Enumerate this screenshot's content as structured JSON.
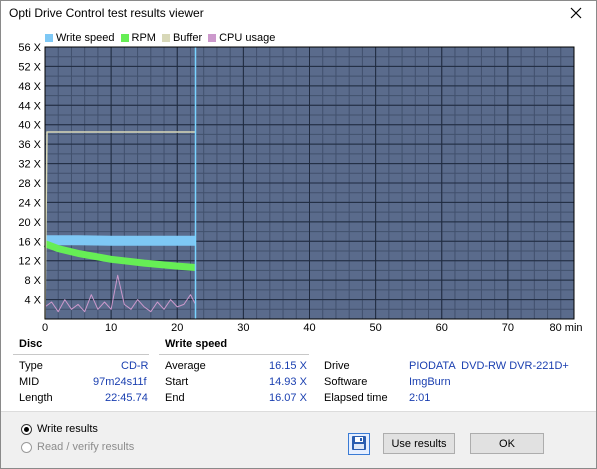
{
  "window": {
    "title": "Opti Drive Control test results viewer"
  },
  "legend": [
    {
      "label": "Write speed",
      "color": "#7ec8f5"
    },
    {
      "label": "RPM",
      "color": "#66ee55"
    },
    {
      "label": "Buffer",
      "color": "#d8d8b8"
    },
    {
      "label": "CPU usage",
      "color": "#cc99cc"
    }
  ],
  "chart_data": {
    "type": "line",
    "xlabel": "min",
    "x_ticks": [
      "0",
      "10",
      "20",
      "30",
      "40",
      "50",
      "60",
      "70",
      "80 min"
    ],
    "y_ticks": [
      "4 X",
      "8 X",
      "12 X",
      "16 X",
      "20 X",
      "24 X",
      "28 X",
      "32 X",
      "36 X",
      "40 X",
      "44 X",
      "48 X",
      "52 X",
      "56 X"
    ],
    "xlim": [
      0,
      80
    ],
    "ylim": [
      0,
      56
    ],
    "end_time_min": 22.76,
    "series": [
      {
        "name": "Write speed",
        "color": "#7ec8f5",
        "x": [
          0,
          5,
          10,
          15,
          20,
          22.76
        ],
        "y": [
          16.2,
          16.2,
          16.1,
          16.1,
          16.1,
          16.1
        ]
      },
      {
        "name": "RPM",
        "color": "#66ee55",
        "x": [
          0,
          2,
          5,
          10,
          15,
          20,
          22.76
        ],
        "y": [
          15.5,
          14.5,
          13.5,
          12.3,
          11.5,
          10.9,
          10.6
        ]
      },
      {
        "name": "Buffer",
        "color": "#d8d8b8",
        "x": [
          0,
          0.3,
          22.76
        ],
        "y": [
          0,
          38.5,
          38.5
        ]
      },
      {
        "name": "CPU usage",
        "color": "#cc99cc",
        "x": [
          0,
          1,
          2,
          3,
          4,
          5,
          6,
          7,
          8,
          9,
          10,
          11,
          12,
          13,
          14,
          15,
          16,
          17,
          18,
          19,
          20,
          21,
          22,
          22.76
        ],
        "y": [
          2.5,
          3.5,
          1.5,
          4,
          2,
          3,
          1.5,
          5,
          2,
          3.5,
          2,
          9,
          3,
          2,
          4,
          2.5,
          1.5,
          3.5,
          2,
          4,
          2.5,
          3,
          5,
          3
        ]
      }
    ]
  },
  "disc": {
    "heading": "Disc",
    "type_label": "Type",
    "type_value": "CD-R",
    "mid_label": "MID",
    "mid_value": "97m24s11f",
    "length_label": "Length",
    "length_value": "22:45.74"
  },
  "write_speed": {
    "heading": "Write speed",
    "average_label": "Average",
    "average_value": "16.15 X",
    "start_label": "Start",
    "start_value": "14.93 X",
    "end_label": "End",
    "end_value": "16.07 X"
  },
  "drive": {
    "drive_label": "Drive",
    "drive_value": "PIODATA  DVD-RW DVR-221D+",
    "software_label": "Software",
    "software_value": "ImgBurn",
    "elapsed_label": "Elapsed time",
    "elapsed_value": "2:01"
  },
  "options": {
    "write_results": "Write results",
    "read_verify_results": "Read / verify results"
  },
  "buttons": {
    "use_results": "Use results",
    "ok": "OK"
  }
}
